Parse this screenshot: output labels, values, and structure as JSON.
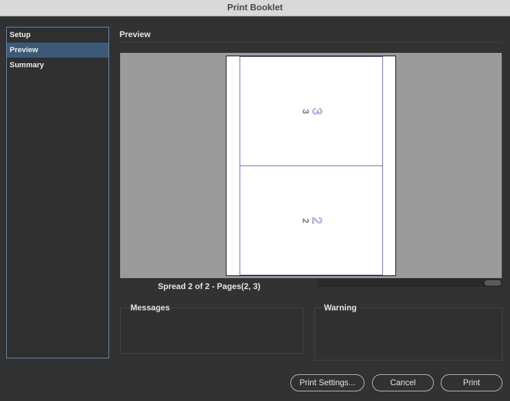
{
  "window": {
    "title": "Print Booklet"
  },
  "sidebar": {
    "items": [
      {
        "label": "Setup",
        "selected": false
      },
      {
        "label": "Preview",
        "selected": true
      },
      {
        "label": "Summary",
        "selected": false
      }
    ]
  },
  "main": {
    "section_title": "Preview",
    "preview": {
      "pages": [
        {
          "number": "3"
        },
        {
          "number": "2"
        }
      ],
      "spread_label": "Spread 2 of 2 - Pages(2, 3)"
    },
    "messages_label": "Messages",
    "warning_label": "Warning"
  },
  "buttons": {
    "print_settings": "Print Settings...",
    "cancel": "Cancel",
    "print": "Print"
  },
  "colors": {
    "selection": "#3c5a78",
    "sidebar_border": "#5b8ec0",
    "page_border": "#6a6ad0"
  }
}
